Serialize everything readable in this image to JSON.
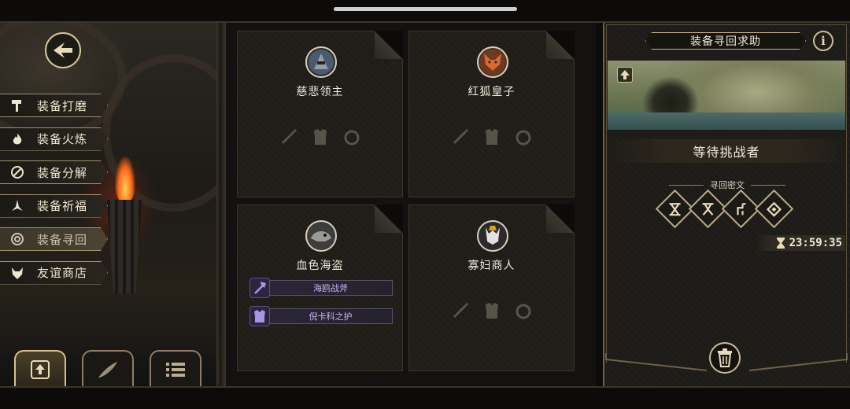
{
  "left_menu": {
    "items": [
      {
        "label": "装备打磨",
        "icon": "hammer-icon"
      },
      {
        "label": "装备火炼",
        "icon": "flame-icon"
      },
      {
        "label": "装备分解",
        "icon": "disassemble-icon"
      },
      {
        "label": "装备祈福",
        "icon": "pray-icon"
      },
      {
        "label": "装备寻回",
        "icon": "recall-icon",
        "active": true
      },
      {
        "label": "友谊商店",
        "icon": "fox-shop-icon"
      }
    ]
  },
  "bottom_tabs": [
    {
      "icon": "upload-icon",
      "active": true
    },
    {
      "icon": "feather-icon",
      "active": false
    },
    {
      "icon": "list-icon",
      "active": false
    }
  ],
  "cards": [
    {
      "name": "慈悲领主",
      "portrait": "armored-lord-portrait-icon",
      "slots": [
        "sword-icon",
        "armor-icon",
        "ring-icon"
      ]
    },
    {
      "name": "红狐皇子",
      "portrait": "red-fox-prince-portrait-icon",
      "slots": [
        "sword-icon",
        "armor-icon",
        "ring-icon"
      ]
    },
    {
      "name": "血色海盗",
      "portrait": "pirate-beast-portrait-icon",
      "items": [
        {
          "label": "海鸥战斧",
          "icon": "axe-icon"
        },
        {
          "label": "倪卡科之护",
          "icon": "armor-icon"
        }
      ]
    },
    {
      "name": "寡妇商人",
      "portrait": "widow-merchant-portrait-icon",
      "slots": [
        "sword-icon",
        "armor-icon",
        "ring-icon"
      ]
    }
  ],
  "right_panel": {
    "title": "装备寻回求助",
    "info_label": "i",
    "status": "等待挑战者",
    "cipher_label": "寻回密文",
    "runes": [
      "rune-x-icon",
      "rune-y-icon",
      "rune-hook-icon",
      "rune-diamond-icon"
    ],
    "timer": "23:59:35"
  },
  "colors": {
    "gold": "#cbbd98",
    "purple_item": "#c3b4ee",
    "background": "#0c0b09"
  }
}
